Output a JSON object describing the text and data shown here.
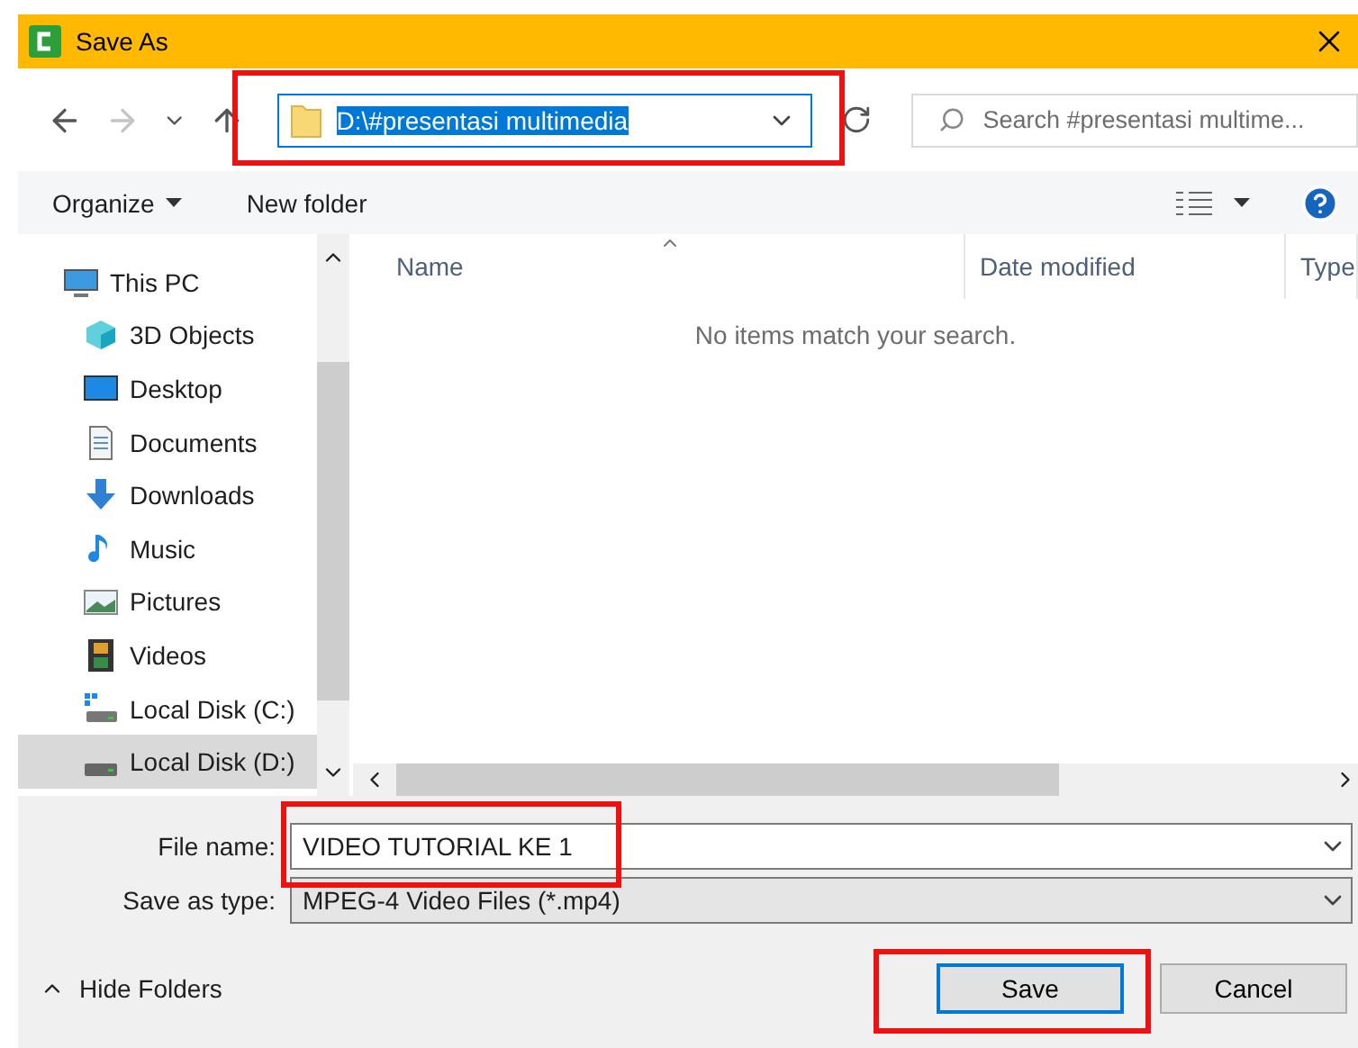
{
  "window": {
    "title": "Save As"
  },
  "address": {
    "path": "D:\\#presentasi multimedia",
    "text_selected": true,
    "highlighted": true
  },
  "search": {
    "placeholder": "Search #presentasi multime..."
  },
  "toolbar": {
    "organize": "Organize",
    "new_folder": "New folder"
  },
  "sidebar": {
    "items": [
      {
        "label": "This PC",
        "kind": "pc",
        "selected": false,
        "children": [
          {
            "label": "3D Objects",
            "kind": "cube",
            "selected": false
          },
          {
            "label": "Desktop",
            "kind": "desktop",
            "selected": false
          },
          {
            "label": "Documents",
            "kind": "document",
            "selected": false
          },
          {
            "label": "Downloads",
            "kind": "download",
            "selected": false
          },
          {
            "label": "Music",
            "kind": "music",
            "selected": false
          },
          {
            "label": "Pictures",
            "kind": "pictures",
            "selected": false
          },
          {
            "label": "Videos",
            "kind": "videos",
            "selected": false
          },
          {
            "label": "Local Disk (C:)",
            "kind": "system-disk",
            "selected": false
          },
          {
            "label": "Local Disk (D:)",
            "kind": "disk",
            "selected": true
          }
        ]
      }
    ]
  },
  "file_list": {
    "columns": [
      {
        "label": "Name",
        "sorted": true
      },
      {
        "label": "Date modified",
        "sorted": false
      },
      {
        "label": "Type",
        "sorted": false
      }
    ],
    "empty_message": "No items match your search."
  },
  "form": {
    "file_name": {
      "label": "File name:",
      "value": "VIDEO TUTORIAL KE 1",
      "highlighted": true
    },
    "file_type": {
      "label": "Save as type:",
      "value": "MPEG-4 Video Files (*.mp4)"
    }
  },
  "hide_folders": "Hide Folders",
  "buttons": [
    {
      "label": "Save",
      "default": true,
      "highlighted": true
    },
    {
      "label": "Cancel",
      "default": false,
      "highlighted": false
    }
  ]
}
